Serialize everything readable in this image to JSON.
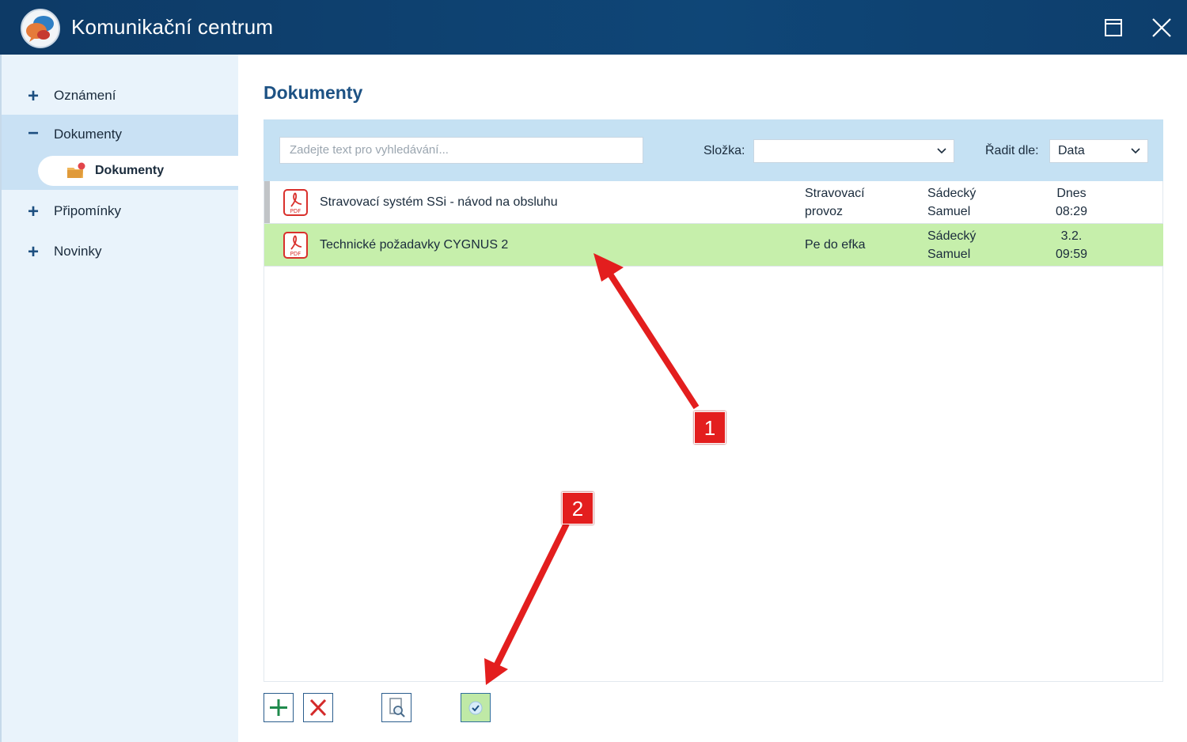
{
  "window": {
    "title": "Komunikační centrum"
  },
  "sidebar": {
    "items": [
      {
        "symbol": "+",
        "label": "Oznámení"
      },
      {
        "symbol": "−",
        "label": "Dokumenty"
      },
      {
        "symbol": "+",
        "label": "Připomínky"
      },
      {
        "symbol": "+",
        "label": "Novinky"
      }
    ],
    "sub_item": {
      "label": "Dokumenty",
      "icon": "folder-notification-icon"
    }
  },
  "main": {
    "title": "Dokumenty",
    "filter": {
      "search_placeholder": "Zadejte text pro vyhledávání...",
      "folder_label": "Složka:",
      "folder_value": "",
      "sort_label": "Řadit dle:",
      "sort_value": "Data"
    },
    "documents": [
      {
        "icon": "pdf-icon",
        "name": "Stravovací systém SSi - návod na obsluhu",
        "folder": [
          "Stravovací",
          "provoz"
        ],
        "author": [
          "Sádecký",
          "Samuel"
        ],
        "date": [
          "Dnes",
          "08:29"
        ],
        "selected": false
      },
      {
        "icon": "pdf-icon",
        "name": "Technické požadavky CYGNUS 2",
        "folder": [
          "Pe do efka"
        ],
        "author": [
          "Sádecký",
          "Samuel"
        ],
        "date": [
          "3.2.",
          "09:59"
        ],
        "selected": true
      }
    ]
  },
  "toolbar": {
    "buttons": [
      {
        "name": "add-button",
        "icon": "plus-icon"
      },
      {
        "name": "delete-button",
        "icon": "x-icon"
      },
      {
        "name": "preview-button",
        "icon": "magnifier-document-icon"
      },
      {
        "name": "confirm-button",
        "icon": "checkmark-icon"
      }
    ]
  },
  "annotations": [
    {
      "label": "1"
    },
    {
      "label": "2"
    }
  ],
  "colors": {
    "titlebar": "#0f4677",
    "sidebar": "#e9f3fb",
    "filterbar": "#c5e1f3",
    "selected_row": "#c6efab",
    "callout": "#e31e1e"
  }
}
